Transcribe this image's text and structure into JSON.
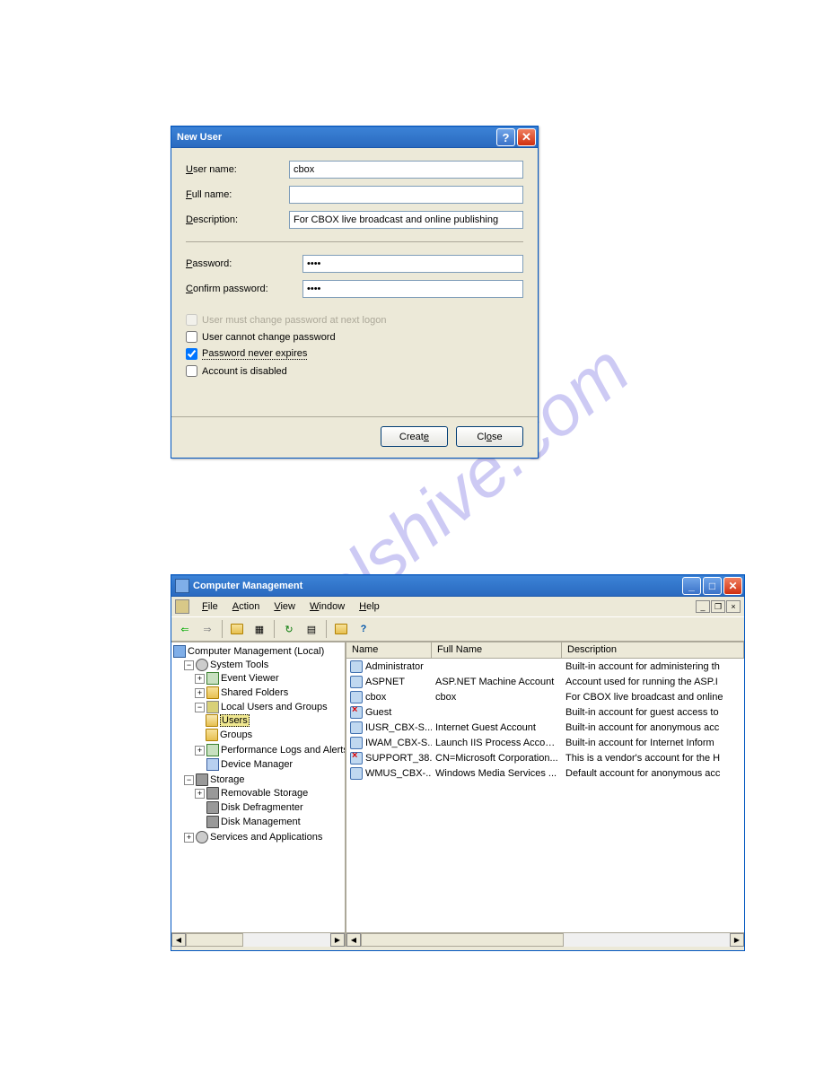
{
  "watermark": "nanualshive.com",
  "dialog": {
    "title": "New User",
    "labels": {
      "username": "User name:",
      "fullname": "Full name:",
      "description": "Description:",
      "password": "Password:",
      "confirm": "Confirm password:"
    },
    "values": {
      "username": "cbox",
      "fullname": "",
      "description": "For CBOX live broadcast and online publishing",
      "password": "••••",
      "confirm": "••••"
    },
    "checks": {
      "mustchange": "User must change password at next logon",
      "cannotchange": "User cannot change password",
      "neverexpires": "Password never expires",
      "disabled": "Account is disabled"
    },
    "buttons": {
      "create": "Create",
      "close": "Close"
    }
  },
  "mmc": {
    "title": "Computer Management",
    "menu": [
      "File",
      "Action",
      "View",
      "Window",
      "Help"
    ],
    "tree": {
      "root": "Computer Management (Local)",
      "systools": "System Tools",
      "eventviewer": "Event Viewer",
      "sharedfolders": "Shared Folders",
      "localusers": "Local Users and Groups",
      "users": "Users",
      "groups": "Groups",
      "perflogs": "Performance Logs and Alerts",
      "devmgr": "Device Manager",
      "storage": "Storage",
      "removable": "Removable Storage",
      "defrag": "Disk Defragmenter",
      "diskmgmt": "Disk Management",
      "services": "Services and Applications"
    },
    "list": {
      "headers": {
        "name": "Name",
        "fullname": "Full Name",
        "desc": "Description"
      },
      "rows": [
        {
          "name": "Administrator",
          "fullname": "",
          "desc": "Built-in account for administering th",
          "icon": "user"
        },
        {
          "name": "ASPNET",
          "fullname": "ASP.NET Machine Account",
          "desc": "Account used for running the ASP.I",
          "icon": "user"
        },
        {
          "name": "cbox",
          "fullname": "cbox",
          "desc": "For CBOX live broadcast and online",
          "icon": "user"
        },
        {
          "name": "Guest",
          "fullname": "",
          "desc": "Built-in account for guest access to",
          "icon": "userx"
        },
        {
          "name": "IUSR_CBX-S...",
          "fullname": "Internet Guest Account",
          "desc": "Built-in account for anonymous acc",
          "icon": "user"
        },
        {
          "name": "IWAM_CBX-S...",
          "fullname": "Launch IIS Process Account",
          "desc": "Built-in account for Internet Inform",
          "icon": "user"
        },
        {
          "name": "SUPPORT_38...",
          "fullname": "CN=Microsoft Corporation...",
          "desc": "This is a vendor's account for the H",
          "icon": "userx"
        },
        {
          "name": "WMUS_CBX-...",
          "fullname": "Windows Media Services ...",
          "desc": "Default account for anonymous acc",
          "icon": "user"
        }
      ]
    }
  }
}
